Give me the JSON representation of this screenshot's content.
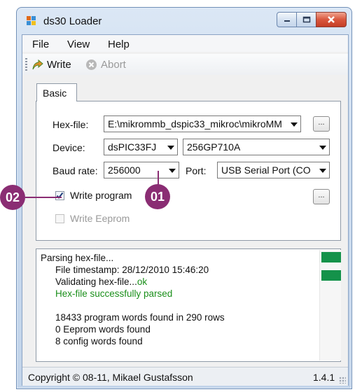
{
  "window": {
    "title": "ds30 Loader"
  },
  "menu": [
    "File",
    "View",
    "Help"
  ],
  "toolbar": {
    "write_label": "Write",
    "abort_label": "Abort"
  },
  "tabs": [
    "Basic"
  ],
  "form": {
    "hexfile_label": "Hex-file:",
    "hexfile_value": "E:\\mikrommb_dspic33_mikroc\\mikroMM",
    "device_label": "Device:",
    "device_family": "dsPIC33FJ",
    "device_model": "256GP710A",
    "baud_label": "Baud rate:",
    "baud_value": "256000",
    "port_label": "Port:",
    "port_value": "USB Serial Port (CO",
    "browse_label": "...",
    "options_label": "...",
    "write_program_label": "Write program",
    "write_program_checked": true,
    "write_eeprom_label": "Write Eeprom",
    "write_eeprom_checked": false
  },
  "log": {
    "line1": "Parsing hex-file...",
    "line2": "File timestamp: 28/12/2010 15:46:20",
    "line3_prefix": "Validating hex-file...",
    "line3_ok": "ok",
    "line4": "Hex-file successfully parsed",
    "line5": "18433 program words found in 290 rows",
    "line6": "0 Eeprom words found",
    "line7": "8 config words found"
  },
  "status": {
    "copyright": "Copyright © 08-11, Mikael Gustafsson",
    "version": "1.4.1"
  },
  "callouts": {
    "badge_01": "01",
    "badge_02": "02"
  },
  "colors": {
    "accent": "#8a2d73",
    "ok_green": "#1a8f1a",
    "progress_green": "#14924a"
  },
  "icons": {
    "write": "arrow-write-icon",
    "abort": "abort-icon",
    "app": "app-icon"
  }
}
